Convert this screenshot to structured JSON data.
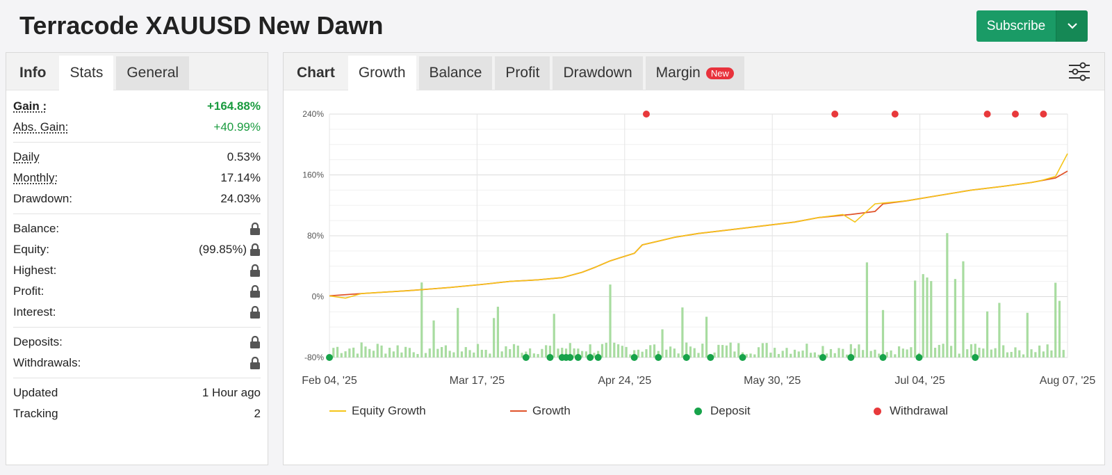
{
  "title": "Terracode XAUUSD New Dawn",
  "subscribe": {
    "label": "Subscribe",
    "icon": "chevron-down-icon"
  },
  "left_tabs": [
    "Info",
    "Stats",
    "General"
  ],
  "right_tabs": [
    "Chart",
    "Growth",
    "Balance",
    "Profit",
    "Drawdown",
    "Margin"
  ],
  "margin_badge": "New",
  "stats": {
    "gain_label": "Gain :",
    "gain": "+164.88%",
    "abs_gain_label": "Abs. Gain:",
    "abs_gain": "+40.99%",
    "daily_label": "Daily",
    "daily": "0.53%",
    "monthly_label": "Monthly:",
    "monthly": "17.14%",
    "drawdown_label": "Drawdown:",
    "drawdown": "24.03%",
    "balance_label": "Balance:",
    "equity_label": "Equity:",
    "equity": "(99.85%)",
    "highest_label": "Highest:",
    "profit_label": "Profit:",
    "interest_label": "Interest:",
    "deposits_label": "Deposits:",
    "withdrawals_label": "Withdrawals:",
    "updated_label": "Updated",
    "updated": "1 Hour ago",
    "tracking_label": "Tracking",
    "tracking": "2"
  },
  "legend": [
    "Equity Growth",
    "Growth",
    "Deposit",
    "Withdrawal"
  ],
  "colors": {
    "equity": "#f5c518",
    "growth": "#e0532a",
    "deposit": "#17a34a",
    "withdrawal": "#e8393b",
    "bars": "#a8dca0",
    "green": "#1a9b3f"
  },
  "chart_data": {
    "type": "line",
    "x_ticks": [
      "Feb 04, '25",
      "Mar 17, '25",
      "Apr 24, '25",
      "May 30, '25",
      "Jul 04, '25",
      "Aug 07, '25"
    ],
    "y_ticks": [
      "240%",
      "160%",
      "80%",
      "0%",
      "-80%"
    ],
    "ylim": [
      -80,
      240
    ],
    "x_range_days": [
      0,
      184
    ],
    "series": [
      {
        "name": "Growth",
        "points": [
          [
            0,
            1
          ],
          [
            8,
            4
          ],
          [
            20,
            8
          ],
          [
            30,
            12
          ],
          [
            38,
            16
          ],
          [
            45,
            20
          ],
          [
            52,
            22
          ],
          [
            58,
            25
          ],
          [
            63,
            32
          ],
          [
            66,
            38
          ],
          [
            70,
            47
          ],
          [
            73,
            52
          ],
          [
            76,
            57
          ],
          [
            78,
            68
          ],
          [
            82,
            73
          ],
          [
            86,
            78
          ],
          [
            92,
            83
          ],
          [
            100,
            88
          ],
          [
            108,
            93
          ],
          [
            116,
            98
          ],
          [
            122,
            104
          ],
          [
            130,
            108
          ],
          [
            136,
            112
          ],
          [
            138,
            122
          ],
          [
            144,
            126
          ],
          [
            152,
            133
          ],
          [
            160,
            140
          ],
          [
            168,
            145
          ],
          [
            175,
            150
          ],
          [
            181,
            156
          ],
          [
            184,
            165
          ]
        ]
      },
      {
        "name": "Equity Growth",
        "points": [
          [
            0,
            1
          ],
          [
            4,
            -2
          ],
          [
            8,
            4
          ],
          [
            20,
            8
          ],
          [
            30,
            12
          ],
          [
            38,
            16
          ],
          [
            45,
            20
          ],
          [
            52,
            22
          ],
          [
            58,
            25
          ],
          [
            63,
            32
          ],
          [
            66,
            38
          ],
          [
            70,
            47
          ],
          [
            73,
            52
          ],
          [
            76,
            57
          ],
          [
            78,
            68
          ],
          [
            82,
            73
          ],
          [
            86,
            78
          ],
          [
            92,
            83
          ],
          [
            100,
            88
          ],
          [
            108,
            93
          ],
          [
            116,
            98
          ],
          [
            122,
            104
          ],
          [
            128,
            108
          ],
          [
            131,
            98
          ],
          [
            136,
            122
          ],
          [
            144,
            126
          ],
          [
            152,
            133
          ],
          [
            160,
            140
          ],
          [
            168,
            145
          ],
          [
            175,
            150
          ],
          [
            177,
            152
          ],
          [
            181,
            158
          ],
          [
            184,
            188
          ]
        ]
      }
    ],
    "deposits_days": [
      0,
      49,
      55,
      58,
      59,
      60,
      62,
      65,
      67,
      76,
      82,
      89,
      95,
      103,
      123,
      130,
      138,
      147,
      161
    ],
    "withdrawals_days": [
      79,
      126,
      141,
      164,
      171,
      178
    ]
  }
}
